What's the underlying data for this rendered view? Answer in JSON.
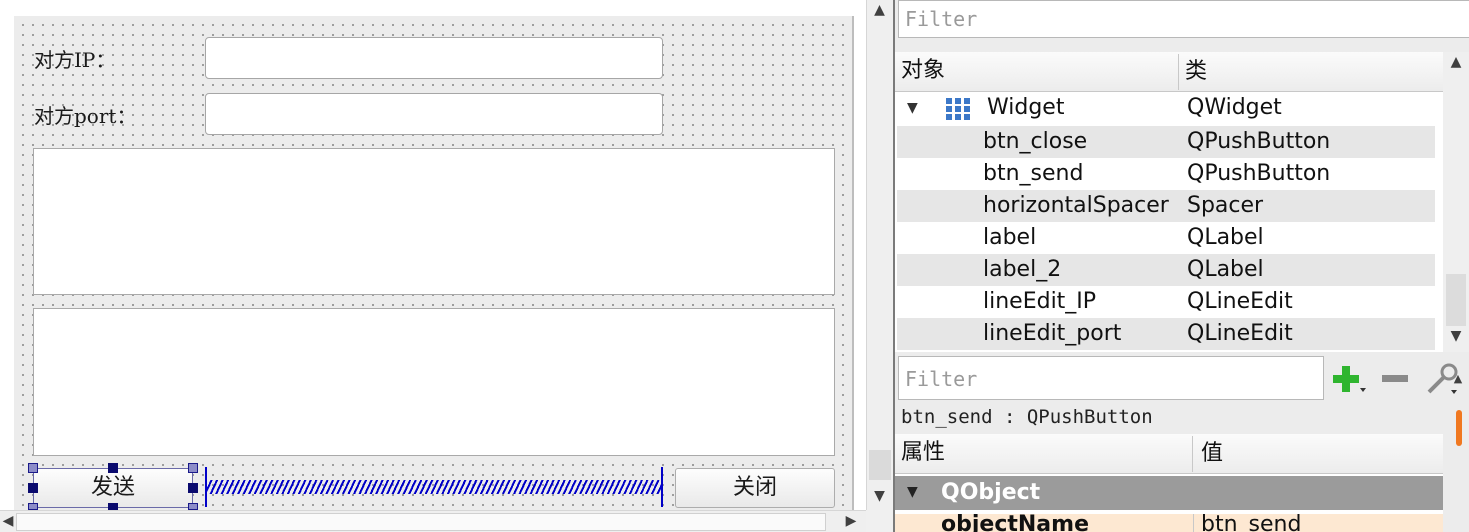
{
  "form": {
    "label_ip": "对方IP：",
    "label_port": "对方port：",
    "btn_send": "发送",
    "btn_close": "关闭"
  },
  "object_inspector": {
    "filter_placeholder": "Filter",
    "col_object": "对象",
    "col_class": "类",
    "root": {
      "name": "Widget",
      "class": "QWidget",
      "icon": "grid-layout-icon"
    },
    "children": [
      {
        "name": "btn_close",
        "class": "QPushButton"
      },
      {
        "name": "btn_send",
        "class": "QPushButton"
      },
      {
        "name": "horizontalSpacer",
        "class": "Spacer"
      },
      {
        "name": "label",
        "class": "QLabel"
      },
      {
        "name": "label_2",
        "class": "QLabel"
      },
      {
        "name": "lineEdit_IP",
        "class": "QLineEdit"
      },
      {
        "name": "lineEdit_port",
        "class": "QLineEdit"
      }
    ]
  },
  "property_editor": {
    "filter_placeholder": "Filter",
    "current_object": "btn_send : QPushButton",
    "col_property": "属性",
    "col_value": "值",
    "group": "QObject",
    "first_row_name": "objectName",
    "first_row_value": "btn_send"
  },
  "colors": {
    "accent_handle": "#0a0a6e",
    "spacer": "#0000c8",
    "group_header": "#9b9b9b",
    "plus_icon": "#2fb52f",
    "scroll_indicator": "#f07820"
  }
}
